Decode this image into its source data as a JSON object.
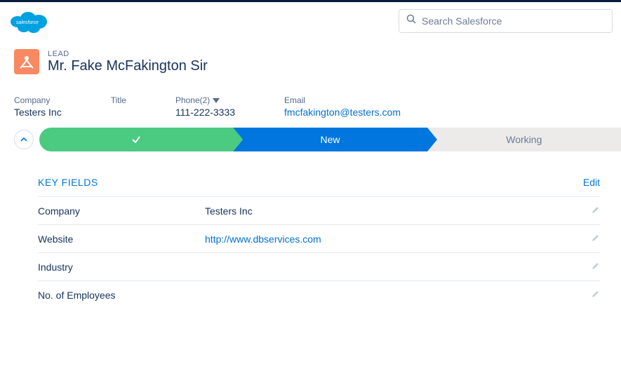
{
  "search": {
    "placeholder": "Search Salesforce"
  },
  "record": {
    "object_label": "LEAD",
    "name": "Mr. Fake McFakington Sir"
  },
  "highlights": {
    "company": {
      "label": "Company",
      "value": "Testers Inc"
    },
    "title": {
      "label": "Title",
      "value": ""
    },
    "phone": {
      "label": "Phone(2)",
      "value": "111-222-3333"
    },
    "email": {
      "label": "Email",
      "value": "fmcfakington@testers.com"
    }
  },
  "path": {
    "stage_current": "New",
    "stage_next": "Working"
  },
  "key_fields": {
    "title": "KEY FIELDS",
    "edit_label": "Edit",
    "rows": {
      "company": {
        "label": "Company",
        "value": "Testers Inc"
      },
      "website": {
        "label": "Website",
        "value": "http://www.dbservices.com"
      },
      "industry": {
        "label": "Industry",
        "value": ""
      },
      "employees": {
        "label": "No. of Employees",
        "value": ""
      }
    }
  }
}
